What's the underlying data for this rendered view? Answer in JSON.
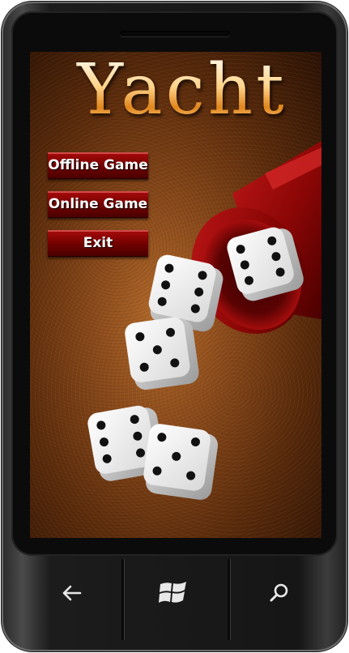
{
  "app": {
    "title": "Yacht"
  },
  "menu": {
    "items": [
      {
        "label": "Offline Game"
      },
      {
        "label": "Online Game"
      },
      {
        "label": "Exit"
      }
    ]
  },
  "hardware_buttons": {
    "back": {
      "icon": "back-arrow-icon"
    },
    "start": {
      "icon": "windows-logo-icon"
    },
    "search": {
      "icon": "search-icon"
    }
  },
  "colors": {
    "title_gold": "#f5c77a",
    "button_red": "#8a0000",
    "background_brown": "#8d4c1c",
    "dice_cup_red": "#b01010"
  }
}
